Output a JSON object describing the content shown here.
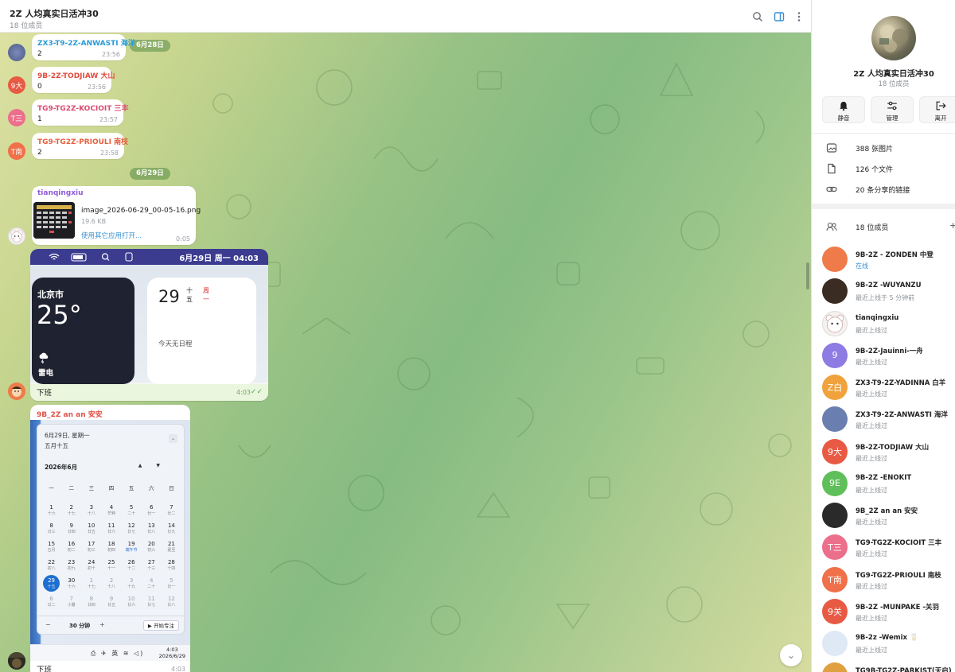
{
  "chat": {
    "title": "2Z 人均真实日活冲30",
    "subtitle": "18 位成员",
    "header_icons": [
      "search-icon",
      "sidebar-toggle-icon",
      "more-vertical-icon"
    ],
    "messages_top": [
      {
        "sender": "ZX3-T9-2Z-ANWASTI 海洋",
        "sender_color": "#2a9bd6",
        "text": "2",
        "time": "23:56"
      },
      {
        "sender": "9B-2Z-TODJIAW 大山",
        "sender_color": "#e04b3d",
        "text": "0",
        "time": "23:56"
      },
      {
        "sender": "TG9-TG2Z-KOCIOIT 三丰",
        "sender_color": "#d94d72",
        "text": "1",
        "time": "23:57"
      },
      {
        "sender": "TG9-TG2Z-PRIOULI 南枝",
        "sender_color": "#e5603d",
        "text": "2",
        "time": "23:58"
      }
    ],
    "avatar_texts": [
      "",
      "9大",
      "T三",
      "T南"
    ],
    "date_separators": [
      "6月28日",
      "6月29日"
    ],
    "file_message": {
      "sender": "tianqingxiu",
      "file_name": "image_2026-06-29_00-05-16.png",
      "file_size": "19.6 KB",
      "open_link": "使用其它应用打开...",
      "time": "0:05"
    },
    "photo_message_1": {
      "status_bar_text": "6月29日 周一  04:03",
      "city": "北京市",
      "temperature": "25°",
      "condition": "雷电",
      "day": "29",
      "lunar_line1": "十",
      "lunar_line2": "五",
      "weekday_line1": "周",
      "weekday_line2": "一",
      "no_schedule": "今天无日程",
      "caption": "下班",
      "time": "4:03",
      "read_check": "✓✓"
    },
    "photo_message_2": {
      "sender": "9B_2Z an an 安安",
      "header_date": "6月29日, 星期一",
      "header_lunar": "五月十五",
      "expand_icon": "⌄",
      "month_label": "2026年6月",
      "month_arrows": "▲▼",
      "week_header": [
        "一",
        "二",
        "三",
        "四",
        "五",
        "六",
        "日"
      ],
      "days": [
        {
          "d": "1",
          "l": "十六"
        },
        {
          "d": "2",
          "l": "十七"
        },
        {
          "d": "3",
          "l": "十八"
        },
        {
          "d": "4",
          "l": "芒种"
        },
        {
          "d": "5",
          "l": "二十"
        },
        {
          "d": "6",
          "l": "廿一"
        },
        {
          "d": "7",
          "l": "廿二"
        },
        {
          "d": "8",
          "l": "廿三"
        },
        {
          "d": "9",
          "l": "廿四"
        },
        {
          "d": "10",
          "l": "廿五"
        },
        {
          "d": "11",
          "l": "廿六"
        },
        {
          "d": "12",
          "l": "廿七"
        },
        {
          "d": "13",
          "l": "廿八"
        },
        {
          "d": "14",
          "l": "廿九"
        },
        {
          "d": "15",
          "l": "五月"
        },
        {
          "d": "16",
          "l": "初二"
        },
        {
          "d": "17",
          "l": "初三"
        },
        {
          "d": "18",
          "l": "初四"
        },
        {
          "d": "19",
          "l": "端午节",
          "fest": true
        },
        {
          "d": "20",
          "l": "初六"
        },
        {
          "d": "21",
          "l": "夏至"
        },
        {
          "d": "22",
          "l": "初八"
        },
        {
          "d": "23",
          "l": "初九"
        },
        {
          "d": "24",
          "l": "初十"
        },
        {
          "d": "25",
          "l": "十一"
        },
        {
          "d": "26",
          "l": "十二"
        },
        {
          "d": "27",
          "l": "十三"
        },
        {
          "d": "28",
          "l": "十四"
        },
        {
          "d": "29",
          "l": "十五",
          "today": true
        },
        {
          "d": "30",
          "l": "十六"
        },
        {
          "d": "1",
          "l": "十七",
          "dim": true
        },
        {
          "d": "2",
          "l": "十八",
          "dim": true
        },
        {
          "d": "3",
          "l": "十九",
          "dim": true
        },
        {
          "d": "4",
          "l": "二十",
          "dim": true
        },
        {
          "d": "5",
          "l": "廿一",
          "dim": true
        },
        {
          "d": "6",
          "l": "廿二",
          "dim": true
        },
        {
          "d": "7",
          "l": "小暑",
          "dim": true
        },
        {
          "d": "8",
          "l": "廿四",
          "dim": true
        },
        {
          "d": "9",
          "l": "廿五",
          "dim": true
        },
        {
          "d": "10",
          "l": "廿六",
          "dim": true
        },
        {
          "d": "11",
          "l": "廿七",
          "dim": true
        },
        {
          "d": "12",
          "l": "廿八",
          "dim": true
        }
      ],
      "minus_label": "−",
      "duration": "30 分钟",
      "plus_label": "+",
      "focus_button": "▶ 开始专注",
      "tray_text": "⎙ ✈ 英 ≋ ◁)",
      "clock_time": "4:03",
      "clock_date": "2026/6/29",
      "caption": "下班",
      "time": "4:03"
    },
    "scroll_down_icon": "⌄"
  },
  "info": {
    "group_name": "2Z 人均真实日活冲30",
    "member_count": "18 位成员",
    "actions": [
      {
        "label": "静音",
        "icon": "bell-icon"
      },
      {
        "label": "管理",
        "icon": "sliders-icon"
      },
      {
        "label": "离开",
        "icon": "leave-icon"
      }
    ],
    "media": [
      {
        "label": "388 张图片",
        "icon": "photo-icon"
      },
      {
        "label": "126 个文件",
        "icon": "file-icon"
      },
      {
        "label": "20 条分享的链接",
        "icon": "link-icon"
      }
    ],
    "members_header": "18 位成员",
    "add_member": "+",
    "members": [
      {
        "name": "9B-2Z - ZONDEN 中登",
        "status": "在线",
        "online": true,
        "avatar": "",
        "color": "#ef7b4a"
      },
      {
        "name": "9B-2Z -WUYANZU",
        "status": "最近上线于 5 分钟前",
        "avatar": "",
        "color": "#3a2c22"
      },
      {
        "name": "tianqingxiu",
        "status": "最近上线过",
        "avatar": "",
        "color": "#f4f1ee"
      },
      {
        "name": "9B-2Z-Jauinni-一舟",
        "status": "最近上线过",
        "avatar": "9",
        "color": "#8e7be3"
      },
      {
        "name": "ZX3-T9-2Z-YADINNA 白羊",
        "status": "最近上线过",
        "avatar": "Z白",
        "color": "#f0a23c"
      },
      {
        "name": "ZX3-T9-2Z-ANWASTI 海洋",
        "status": "最近上线过",
        "avatar": "",
        "color": "#6a7fb0"
      },
      {
        "name": "9B-2Z-TODJIAW 大山",
        "status": "最近上线过",
        "avatar": "9大",
        "color": "#e85a44"
      },
      {
        "name": "9B-2Z -ENOKIT",
        "status": "最近上线过",
        "avatar": "9E",
        "color": "#5fbf5a"
      },
      {
        "name": "9B_2Z an an 安安",
        "status": "最近上线过",
        "avatar": "",
        "color": "#2a2a2a"
      },
      {
        "name": "TG9-TG2Z-KOCIOIT 三丰",
        "status": "最近上线过",
        "avatar": "T三",
        "color": "#ec6f8c"
      },
      {
        "name": "TG9-TG2Z-PRIOULI 南枝",
        "status": "最近上线过",
        "avatar": "T南",
        "color": "#ef7049"
      },
      {
        "name": "9B-2Z -MUNPAKE -关羽",
        "status": "最近上线过",
        "avatar": "9关",
        "color": "#e85a44"
      },
      {
        "name": "9B-2z -Wemix 🥛",
        "status": "最近上线过",
        "avatar": "",
        "color": "#dfe8f5"
      },
      {
        "name": "TG9B-TG2Z-PARKIST(天启)",
        "status": "",
        "avatar": "",
        "color": "#e0a040"
      }
    ]
  },
  "colors": {
    "accent": "#3a8fcf",
    "date_pill": "#6b9b58",
    "online": "#3a8fcf"
  }
}
